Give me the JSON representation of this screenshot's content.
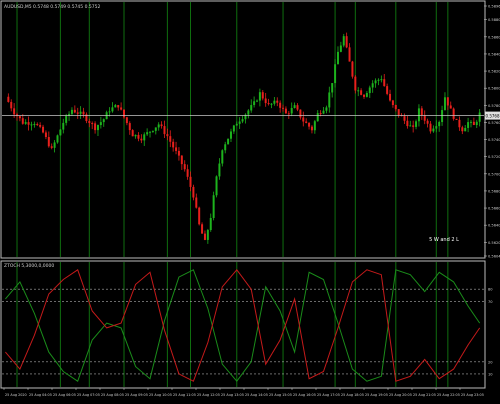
{
  "window": {
    "symbol_label": "AUDUSD,M5 0.5748 0.5749 0.5745 0.5752",
    "price_tag": "0.5768",
    "annotation": "5 W and 2 L"
  },
  "indicator": {
    "label": "ZTOCH 5,3000,0,0000",
    "levels_label": [
      "80",
      "70",
      "20",
      "10"
    ]
  },
  "colors": {
    "background": "#000000",
    "bull_candle": "#1db31d",
    "bear_candle": "#e8201c",
    "vertical_line": "#0f6e0f",
    "price_line": "#c8c8c8",
    "osc_green": "#1a8c1a",
    "osc_red": "#c41a1a",
    "level_line": "#aaaaaa",
    "frame": "#bbbbbb"
  },
  "chart_data": [
    {
      "type": "candlestick",
      "title": "AUDUSD,M5 0.5748 0.5749 0.5745 0.5752",
      "ylim": [
        0.5604,
        0.5896
      ],
      "y_ticks": [
        "0.5896",
        "0.5880",
        "0.5860",
        "0.5840",
        "0.5820",
        "0.5800",
        "0.5780",
        "0.5768",
        "0.5760",
        "0.5740",
        "0.5720",
        "0.5700",
        "0.5680",
        "0.5660",
        "0.5640",
        "0.5620",
        "0.5604"
      ],
      "current_price": 0.5768,
      "x_tick_labels": [
        "25 Aug 2020",
        "25 Aug 04:05",
        "25 Aug 06:05",
        "25 Aug 07:05",
        "25 Aug 08:05",
        "25 Aug 09:05",
        "25 Aug 10:05",
        "25 Aug 11:05",
        "25 Aug 12:05",
        "25 Aug 13:05",
        "25 Aug 14:05",
        "25 Aug 15:05",
        "25 Aug 16:05",
        "25 Aug 17:05",
        "25 Aug 18:05",
        "25 Aug 19:05",
        "25 Aug 20:05",
        "25 Aug 21:05",
        "25 Aug 22:05",
        "25 Aug 23:05"
      ],
      "vertical_markers": [
        4,
        19,
        29,
        41,
        56,
        64,
        80,
        96,
        114,
        121,
        135,
        149,
        153
      ],
      "close_path": [
        [
          0,
          0.579
        ],
        [
          3,
          0.5772
        ],
        [
          6,
          0.576
        ],
        [
          10,
          0.576
        ],
        [
          13,
          0.5748
        ],
        [
          16,
          0.5728
        ],
        [
          18,
          0.5744
        ],
        [
          20,
          0.576
        ],
        [
          23,
          0.5775
        ],
        [
          27,
          0.5768
        ],
        [
          31,
          0.5754
        ],
        [
          34,
          0.5764
        ],
        [
          36,
          0.5775
        ],
        [
          39,
          0.578
        ],
        [
          41,
          0.5766
        ],
        [
          44,
          0.5746
        ],
        [
          47,
          0.5742
        ],
        [
          50,
          0.575
        ],
        [
          53,
          0.5758
        ],
        [
          56,
          0.5744
        ],
        [
          59,
          0.5725
        ],
        [
          62,
          0.5705
        ],
        [
          65,
          0.5675
        ],
        [
          67,
          0.564
        ],
        [
          69,
          0.562
        ],
        [
          71,
          0.565
        ],
        [
          73,
          0.5695
        ],
        [
          75,
          0.573
        ],
        [
          78,
          0.5748
        ],
        [
          80,
          0.576
        ],
        [
          83,
          0.577
        ],
        [
          86,
          0.5782
        ],
        [
          88,
          0.5794
        ],
        [
          91,
          0.578
        ],
        [
          94,
          0.5784
        ],
        [
          97,
          0.577
        ],
        [
          100,
          0.5778
        ],
        [
          103,
          0.5762
        ],
        [
          106,
          0.5752
        ],
        [
          108,
          0.577
        ],
        [
          111,
          0.578
        ],
        [
          113,
          0.5808
        ],
        [
          115,
          0.5842
        ],
        [
          117,
          0.586
        ],
        [
          119,
          0.583
        ],
        [
          121,
          0.58
        ],
        [
          124,
          0.5792
        ],
        [
          127,
          0.5806
        ],
        [
          130,
          0.5812
        ],
        [
          133,
          0.5784
        ],
        [
          135,
          0.5774
        ],
        [
          138,
          0.5762
        ],
        [
          141,
          0.5752
        ],
        [
          143,
          0.5774
        ],
        [
          145,
          0.5764
        ],
        [
          147,
          0.5752
        ],
        [
          150,
          0.5762
        ],
        [
          152,
          0.579
        ],
        [
          154,
          0.5774
        ],
        [
          156,
          0.576
        ],
        [
          158,
          0.5752
        ],
        [
          160,
          0.576
        ],
        [
          162,
          0.5756
        ],
        [
          164,
          0.577
        ]
      ]
    },
    {
      "type": "line",
      "title": "ZTOCH 5,3000,0,0000",
      "ylim": [
        0,
        100
      ],
      "levels": [
        80,
        70,
        20,
        10
      ],
      "series": [
        {
          "name": "",
          "color": "green",
          "points": [
            [
              0,
              72
            ],
            [
              5,
              86
            ],
            [
              10,
              60
            ],
            [
              15,
              28
            ],
            [
              20,
              12
            ],
            [
              25,
              4
            ],
            [
              30,
              38
            ],
            [
              35,
              52
            ],
            [
              40,
              48
            ],
            [
              45,
              16
            ],
            [
              50,
              6
            ],
            [
              55,
              54
            ],
            [
              60,
              90
            ],
            [
              65,
              96
            ],
            [
              70,
              64
            ],
            [
              75,
              18
            ],
            [
              80,
              4
            ],
            [
              85,
              20
            ],
            [
              90,
              82
            ],
            [
              95,
              62
            ],
            [
              100,
              28
            ],
            [
              105,
              94
            ],
            [
              110,
              88
            ],
            [
              115,
              52
            ],
            [
              120,
              14
            ],
            [
              125,
              4
            ],
            [
              130,
              8
            ],
            [
              135,
              96
            ],
            [
              140,
              92
            ],
            [
              145,
              78
            ],
            [
              150,
              94
            ],
            [
              155,
              86
            ],
            [
              160,
              66
            ],
            [
              164,
              52
            ]
          ]
        },
        {
          "name": "",
          "color": "red",
          "points": [
            [
              0,
              28
            ],
            [
              5,
              14
            ],
            [
              10,
              42
            ],
            [
              15,
              76
            ],
            [
              20,
              88
            ],
            [
              25,
              96
            ],
            [
              30,
              62
            ],
            [
              35,
              48
            ],
            [
              40,
              52
            ],
            [
              45,
              84
            ],
            [
              50,
              94
            ],
            [
              55,
              46
            ],
            [
              60,
              10
            ],
            [
              65,
              4
            ],
            [
              70,
              36
            ],
            [
              75,
              82
            ],
            [
              80,
              96
            ],
            [
              85,
              80
            ],
            [
              90,
              18
            ],
            [
              95,
              38
            ],
            [
              100,
              72
            ],
            [
              105,
              6
            ],
            [
              110,
              12
            ],
            [
              115,
              48
            ],
            [
              120,
              86
            ],
            [
              125,
              96
            ],
            [
              130,
              92
            ],
            [
              135,
              4
            ],
            [
              140,
              8
            ],
            [
              145,
              22
            ],
            [
              150,
              6
            ],
            [
              155,
              14
            ],
            [
              160,
              34
            ],
            [
              164,
              48
            ]
          ]
        }
      ]
    }
  ]
}
